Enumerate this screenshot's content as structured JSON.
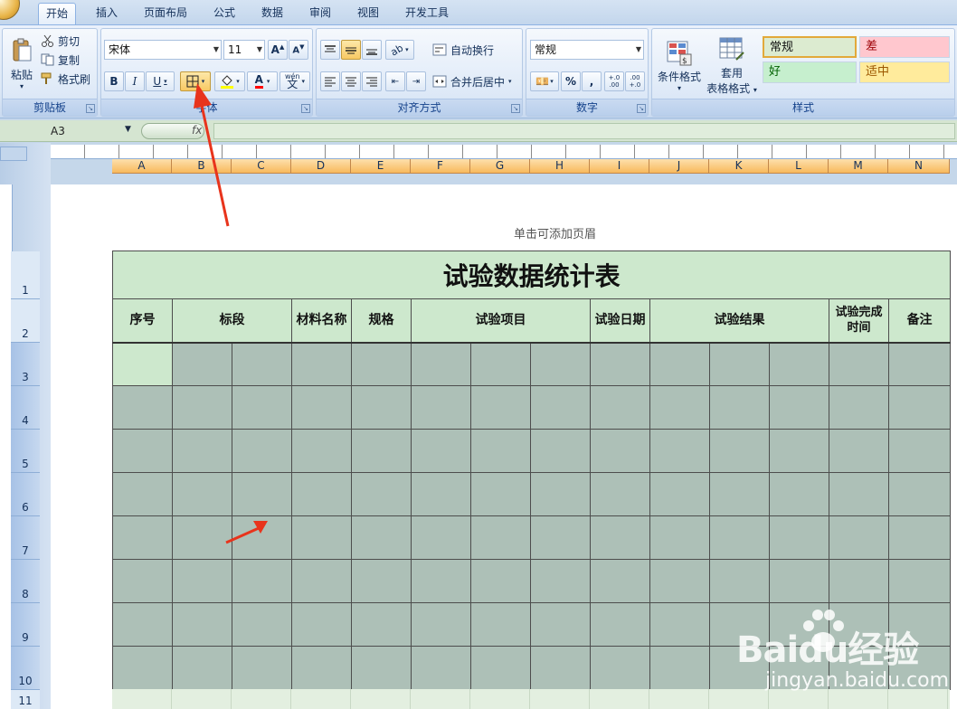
{
  "tabs": [
    "开始",
    "插入",
    "页面布局",
    "公式",
    "数据",
    "审阅",
    "视图",
    "开发工具"
  ],
  "active_tab": "开始",
  "clipboard": {
    "paste": "粘贴",
    "cut": "剪切",
    "copy": "复制",
    "format_painter": "格式刷",
    "label": "剪贴板"
  },
  "font": {
    "name": "宋体",
    "size": "11",
    "bold": "B",
    "italic": "I",
    "underline": "U",
    "font_color_letter": "A",
    "label": "字体",
    "phonetic": "wén"
  },
  "alignment": {
    "wrap_text": "自动换行",
    "merge_center": "合并后居中",
    "label": "对齐方式"
  },
  "number": {
    "format": "常规",
    "percent": "%",
    "comma": ",",
    "label": "数字",
    "dec_inc": "+.0 .00",
    "dec_dec": ".00 +.0"
  },
  "styles": {
    "conditional_format": "条件格式",
    "format_table_line1": "套用",
    "format_table_line2": "表格格式",
    "cells": [
      {
        "text": "常规",
        "bg": "#dcebd0",
        "color": "#111111"
      },
      {
        "text": "差",
        "bg": "#ffc7ce",
        "color": "#9c0006"
      },
      {
        "text": "好",
        "bg": "#c6efce",
        "color": "#006100"
      },
      {
        "text": "适中",
        "bg": "#ffeb9c",
        "color": "#9c5700"
      }
    ],
    "label": "样式"
  },
  "formula_bar": {
    "name_box": "A3",
    "fx": "fx",
    "value": ""
  },
  "columns": [
    "A",
    "B",
    "C",
    "D",
    "E",
    "F",
    "G",
    "H",
    "I",
    "J",
    "K",
    "L",
    "M",
    "N"
  ],
  "rows": [
    "1",
    "2",
    "3",
    "4",
    "5",
    "6",
    "7",
    "8",
    "9",
    "10",
    "11"
  ],
  "page_header_hint": "单击可添加页眉",
  "sheet": {
    "title": "试验数据统计表",
    "headers": [
      {
        "text": "序号",
        "span": 1
      },
      {
        "text": "标段",
        "span": 2
      },
      {
        "text": "材料名称",
        "span": 1
      },
      {
        "text": "规格",
        "span": 1
      },
      {
        "text": "试验项目",
        "span": 3
      },
      {
        "text": "试验日期",
        "span": 1
      },
      {
        "text": "试验结果",
        "span": 3
      },
      {
        "text": "试验完成时间",
        "span": 1
      },
      {
        "text": "备注",
        "span": 1
      }
    ],
    "data_row_count": 8
  },
  "watermark": {
    "logo": "Baidu经验",
    "sub": "jingyan.baidu.com"
  },
  "colors": {
    "header_fill": "#cde8cd",
    "data_fill": "#adc0b7",
    "arrow": "#e8341c"
  }
}
